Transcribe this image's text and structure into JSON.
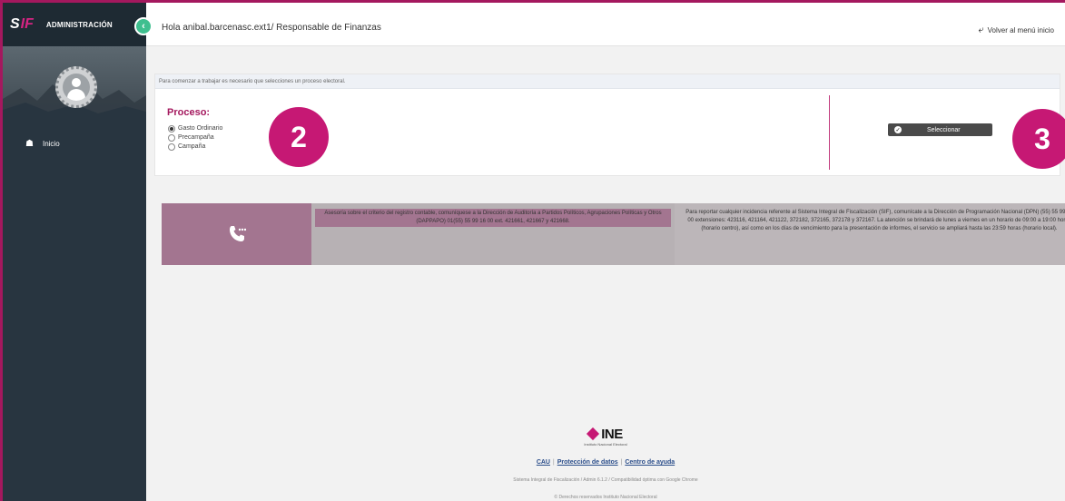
{
  "sidebar": {
    "logo_s": "S",
    "logo_if": "IF",
    "title": "ADMINISTRACIÓN",
    "items": [
      {
        "label": "Inicio",
        "icon": "home-icon"
      }
    ]
  },
  "header": {
    "greeting": "Hola anibal.barcenasc.ext1/ Responsable de Finanzas",
    "back_label": "Volver al menú inicio"
  },
  "panel": {
    "info": "Para comenzar a trabajar es necesario que selecciones un proceso electoral.",
    "proceso_label": "Proceso:",
    "options": [
      {
        "label": "Gasto Ordinario",
        "selected": true
      },
      {
        "label": "Precampaña",
        "selected": false
      },
      {
        "label": "Campaña",
        "selected": false
      }
    ],
    "select_button": "Seleccionar"
  },
  "markers": {
    "two": "2",
    "three": "3"
  },
  "help": {
    "mid_text": "Asesoría sobre el criterio del registro contable, comuníquese a la Dirección de Auditoría a Partidos Políticos, Agrupaciones Políticas y Otros (DAPPAPO) 01(55) 55 99 16 00 ext. 421661, 421667 y 421668.",
    "right_text": "Para reportar cualquier incidencia referente al Sistema Integral de Fiscalización (SIF), comunícate a la Dirección de Programación Nacional (DPN) (55) 55 99 16 00 extensiones: 423116, 421164, 421122, 372182, 372165, 372178 y 372167. La atención se brindará de lunes a viernes en un horario de 09:00 a 19:00 horas (horario centro), así como en los días de vencimiento para la presentación de informes, el servicio se ampliará hasta las 23:59 horas (horario local)."
  },
  "footer": {
    "ine": "INE",
    "ine_sub": "Instituto Nacional Electoral",
    "link_cau": "CAU",
    "link_proteccion": "Protección de datos",
    "link_ayuda": "Centro de ayuda",
    "system_text": "Sistema Integral de Fiscalización / Admin 6.1.2 / Compatibilidad óptima con Google Chrome",
    "rights": "© Derechos reservados Instituto Nacional Electoral"
  },
  "colors": {
    "brand": "#a4185e",
    "marker": "#c61874",
    "sidebar": "#283540",
    "accent_green": "#3fbf8f"
  }
}
